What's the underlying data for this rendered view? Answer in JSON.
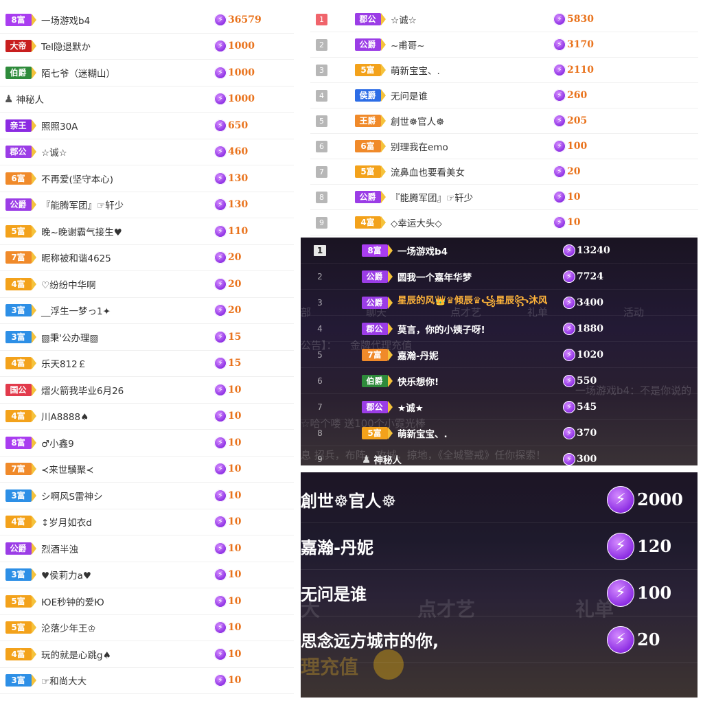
{
  "colors": {
    "富8": "#a93df0",
    "富7": "#f08a2a",
    "富6": "#f08a2a",
    "富5": "#f3a21b",
    "富4": "#f3a21b",
    "富3": "#2d8fe6",
    "公爵": "#9b3de6",
    "郡公": "#9b3de6",
    "国公": "#e23b4c",
    "伯爵": "#2e8b3b",
    "侯爵": "#2d6de6",
    "王爵": "#f08a2a",
    "大帝": "#c81e1e",
    "亲王": "#8b2be2",
    "amount": "#e9731d"
  },
  "left_list": [
    {
      "badge": "8富",
      "kind": "富8",
      "name": "一场游戏b4",
      "value": "36579"
    },
    {
      "badge": "大帝",
      "kind": "大帝",
      "name": "Tel隐退默か",
      "value": "1000"
    },
    {
      "badge": "伯爵",
      "kind": "伯爵",
      "name": "陌七爷（迷糊山）",
      "value": "1000"
    },
    {
      "badge": "",
      "kind": "mystery",
      "name": "神秘人",
      "value": "1000"
    },
    {
      "badge": "亲王",
      "kind": "亲王",
      "name": "照照30A",
      "value": "650"
    },
    {
      "badge": "郡公",
      "kind": "郡公",
      "name": "☆诚☆",
      "value": "460"
    },
    {
      "badge": "6富",
      "kind": "富6",
      "name": "不再爱(坚守本心)",
      "value": "130"
    },
    {
      "badge": "公爵",
      "kind": "公爵",
      "name": "『能腾军团』☞轩少",
      "value": "130"
    },
    {
      "badge": "5富",
      "kind": "富5",
      "name": "晚~晚谢霸气接生♥",
      "value": "110"
    },
    {
      "badge": "7富",
      "kind": "富7",
      "name": "昵称被和谐4625",
      "value": "20"
    },
    {
      "badge": "4富",
      "kind": "富4",
      "name": "♡纷纷中华啊",
      "value": "20"
    },
    {
      "badge": "3富",
      "kind": "富3",
      "name": "__浮生一梦っ1✦",
      "value": "20"
    },
    {
      "badge": "3富",
      "kind": "富3",
      "name": "▨秉'公办理▨",
      "value": "15"
    },
    {
      "badge": "4富",
      "kind": "富4",
      "name": "乐天812￡",
      "value": "15"
    },
    {
      "badge": "国公",
      "kind": "国公",
      "name": "熠火箭我毕业6月26",
      "value": "10"
    },
    {
      "badge": "4富",
      "kind": "富4",
      "name": "川A8888♠",
      "value": "10"
    },
    {
      "badge": "8富",
      "kind": "富8",
      "name": "♂小鑫9",
      "value": "10"
    },
    {
      "badge": "7富",
      "kind": "富7",
      "name": "≺来世驥聚≺",
      "value": "10"
    },
    {
      "badge": "3富",
      "kind": "富3",
      "name": "シ啊风S雷神シ",
      "value": "10"
    },
    {
      "badge": "4富",
      "kind": "富4",
      "name": "↕岁月如衣d",
      "value": "10"
    },
    {
      "badge": "公爵",
      "kind": "公爵",
      "name": "烈酒半浊",
      "value": "10"
    },
    {
      "badge": "3富",
      "kind": "富3",
      "name": "♥侯莉力a♥",
      "value": "10"
    },
    {
      "badge": "5富",
      "kind": "富5",
      "name": "ЮE秒钟的爱Ю",
      "value": "10"
    },
    {
      "badge": "5富",
      "kind": "富5",
      "name": "沦落少年王♔",
      "value": "10"
    },
    {
      "badge": "4富",
      "kind": "富4",
      "name": "玩的就是心跳g♠",
      "value": "10"
    },
    {
      "badge": "3富",
      "kind": "富3",
      "name": "☞和尚大大",
      "value": "10"
    }
  ],
  "right_top_list": [
    {
      "rank": "1",
      "badge": "郡公",
      "kind": "郡公",
      "name": "☆诚☆",
      "value": "5830"
    },
    {
      "rank": "2",
      "badge": "公爵",
      "kind": "公爵",
      "name": "~甫哥~",
      "value": "3170"
    },
    {
      "rank": "3",
      "badge": "5富",
      "kind": "富5",
      "name": "萌新宝宝、.",
      "value": "2110"
    },
    {
      "rank": "4",
      "badge": "侯爵",
      "kind": "侯爵",
      "name": "无问是谁",
      "value": "260"
    },
    {
      "rank": "5",
      "badge": "王爵",
      "kind": "王爵",
      "name": "創世☸官人☸",
      "value": "205"
    },
    {
      "rank": "6",
      "badge": "6富",
      "kind": "富6",
      "name": "别理我在emo",
      "value": "100"
    },
    {
      "rank": "7",
      "badge": "5富",
      "kind": "富5",
      "name": "流鼻血也要看美女",
      "value": "20"
    },
    {
      "rank": "8",
      "badge": "公爵",
      "kind": "公爵",
      "name": "『能腾军团』☞轩少",
      "value": "10"
    },
    {
      "rank": "9",
      "badge": "4富",
      "kind": "富4",
      "name": "◇幸运大头◇",
      "value": "10"
    }
  ],
  "dark_list": [
    {
      "rank": "1",
      "badge": "8富",
      "kind": "富8",
      "name": "一场游戏b4",
      "value": "13240",
      "gold": false
    },
    {
      "rank": "2",
      "badge": "公爵",
      "kind": "公爵",
      "name": "圆我一个嘉年华梦",
      "value": "7724",
      "gold": false
    },
    {
      "rank": "3",
      "badge": "公爵",
      "kind": "公爵",
      "name": "星辰的风👑♛倾辰♛꧁星辰꧂沐风",
      "value": "3400",
      "gold": true
    },
    {
      "rank": "4",
      "badge": "郡公",
      "kind": "郡公",
      "name": "莫言，你的小姨子呀!",
      "value": "1880",
      "gold": false
    },
    {
      "rank": "5",
      "badge": "7富",
      "kind": "富7",
      "name": "嘉瀚-丹妮",
      "value": "1020",
      "gold": false
    },
    {
      "rank": "6",
      "badge": "伯爵",
      "kind": "伯爵",
      "name": "快乐想你!",
      "value": "550",
      "gold": false
    },
    {
      "rank": "7",
      "badge": "郡公",
      "kind": "郡公",
      "name": "★诚★",
      "value": "545",
      "gold": false
    },
    {
      "rank": "8",
      "badge": "5富",
      "kind": "富5",
      "name": "萌新宝宝、.",
      "value": "370",
      "gold": false
    },
    {
      "rank": "9",
      "badge": "",
      "kind": "mystery",
      "name": "神秘人",
      "value": "300",
      "gold": false
    }
  ],
  "dark_ghost": {
    "tab_a": "部",
    "tab_b": "聊天",
    "tab_c": "点才艺",
    "tab_d": "礼单",
    "tab_e": "活动",
    "notice": "公告】：",
    "agent": "金牌代理充值",
    "chat": "一场游戏b4：不是你说的",
    "line": "☆哈个喽 送100个小霓光棒",
    "promo": "息 招兵，布阵，攻城，掠地，《全城警戒》任你探索！"
  },
  "zoom_list": [
    {
      "name": "創世☸官人☸",
      "value": "2000"
    },
    {
      "name": "嘉瀚-丹妮",
      "value": "120"
    },
    {
      "name": "无问是谁",
      "value": "100"
    },
    {
      "name": "思念远方城市的你,",
      "value": "20"
    }
  ],
  "zoom_ghost": {
    "tab_a": "大",
    "tab_b": "点才艺",
    "tab_c": "礼单",
    "agent": "理充值"
  }
}
